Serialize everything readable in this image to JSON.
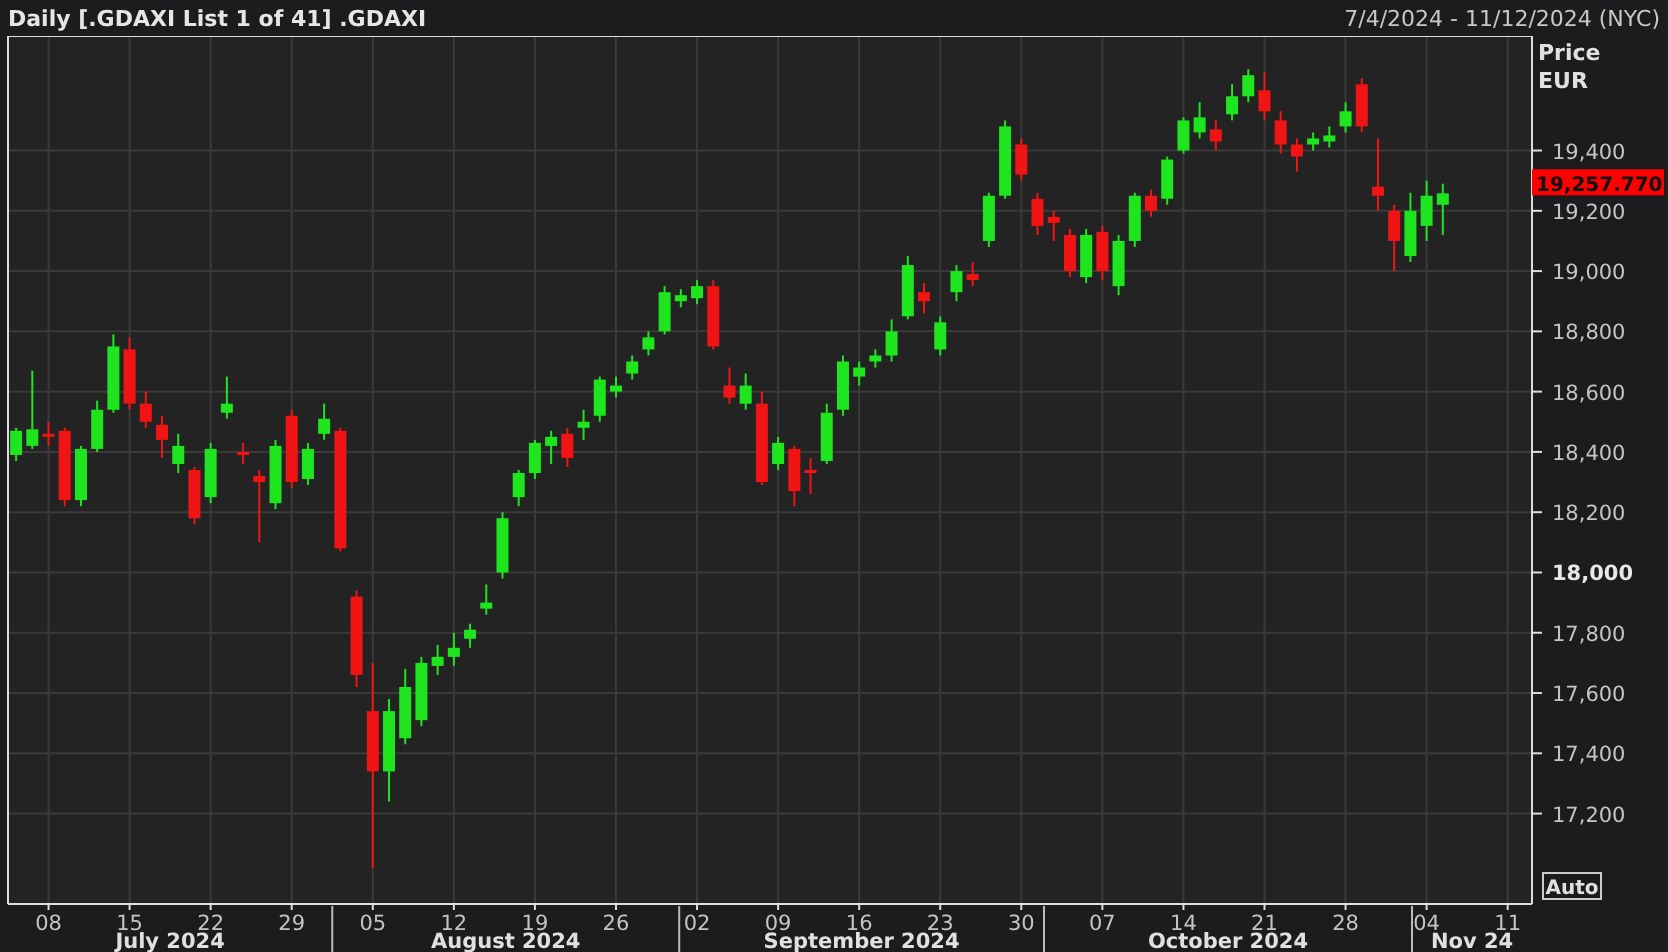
{
  "header": {
    "title": "Daily [.GDAXI List 1 of 41] .GDAXI",
    "range": "7/4/2024 - 11/12/2024 (NYC)"
  },
  "chart_data": {
    "type": "candlestick",
    "ylabel": "Price",
    "grid": true,
    "categories": [
      null,
      null,
      "08",
      null,
      null,
      null,
      null,
      "15",
      null,
      null,
      null,
      null,
      "22",
      null,
      null,
      null,
      null,
      "29",
      null,
      null,
      null,
      null,
      "05",
      null,
      null,
      null,
      null,
      "12",
      null,
      null,
      null,
      null,
      "19",
      null,
      null,
      null,
      null,
      "26",
      null,
      null,
      null,
      null,
      "02",
      null,
      null,
      null,
      null,
      "09",
      null,
      null,
      null,
      null,
      "16",
      null,
      null,
      null,
      null,
      "23",
      null,
      null,
      null,
      null,
      "30",
      null,
      null,
      null,
      null,
      "07",
      null,
      null,
      null,
      null,
      "14",
      null,
      null,
      null,
      null,
      "21",
      null,
      null,
      null,
      null,
      "28",
      null,
      null,
      null,
      null,
      "04",
      null,
      null,
      null,
      null,
      "11"
    ],
    "ohlc": [
      [
        18390,
        18480,
        18370,
        18470
      ],
      [
        18420,
        18670,
        18410,
        18475
      ],
      [
        18460,
        18500,
        18420,
        18450
      ],
      [
        18470,
        18480,
        18220,
        18240
      ],
      [
        18240,
        18420,
        18220,
        18410
      ],
      [
        18410,
        18570,
        18400,
        18540
      ],
      [
        18540,
        18790,
        18530,
        18750
      ],
      [
        18740,
        18780,
        18540,
        18560
      ],
      [
        18560,
        18600,
        18480,
        18500
      ],
      [
        18490,
        18520,
        18380,
        18440
      ],
      [
        18360,
        18460,
        18330,
        18420
      ],
      [
        18340,
        18350,
        18160,
        18180
      ],
      [
        18250,
        18430,
        18230,
        18410
      ],
      [
        18530,
        18650,
        18510,
        18560
      ],
      [
        18400,
        18430,
        18360,
        18390
      ],
      [
        18320,
        18340,
        18100,
        18300
      ],
      [
        18230,
        18440,
        18210,
        18420
      ],
      [
        18520,
        18540,
        18280,
        18300
      ],
      [
        18310,
        18430,
        18290,
        18410
      ],
      [
        18460,
        18560,
        18440,
        18510
      ],
      [
        18470,
        18480,
        18070,
        18080
      ],
      [
        17920,
        17940,
        17620,
        17660
      ],
      [
        17540,
        17700,
        17020,
        17340
      ],
      [
        17340,
        17580,
        17240,
        17540
      ],
      [
        17450,
        17680,
        17430,
        17620
      ],
      [
        17510,
        17720,
        17490,
        17700
      ],
      [
        17690,
        17760,
        17660,
        17720
      ],
      [
        17720,
        17800,
        17690,
        17750
      ],
      [
        17780,
        17830,
        17750,
        17810
      ],
      [
        17880,
        17960,
        17860,
        17900
      ],
      [
        18000,
        18200,
        17980,
        18180
      ],
      [
        18250,
        18340,
        18220,
        18330
      ],
      [
        18330,
        18440,
        18310,
        18430
      ],
      [
        18420,
        18470,
        18360,
        18450
      ],
      [
        18460,
        18480,
        18350,
        18380
      ],
      [
        18480,
        18540,
        18440,
        18500
      ],
      [
        18520,
        18650,
        18500,
        18640
      ],
      [
        18600,
        18650,
        18580,
        18620
      ],
      [
        18660,
        18720,
        18640,
        18700
      ],
      [
        18740,
        18800,
        18720,
        18780
      ],
      [
        18800,
        18950,
        18790,
        18930
      ],
      [
        18900,
        18940,
        18880,
        18920
      ],
      [
        18910,
        18970,
        18890,
        18950
      ],
      [
        18950,
        18970,
        18740,
        18750
      ],
      [
        18620,
        18680,
        18560,
        18580
      ],
      [
        18560,
        18660,
        18540,
        18620
      ],
      [
        18560,
        18600,
        18290,
        18300
      ],
      [
        18360,
        18450,
        18340,
        18430
      ],
      [
        18410,
        18420,
        18220,
        18270
      ],
      [
        18340,
        18380,
        18260,
        18330
      ],
      [
        18370,
        18560,
        18360,
        18530
      ],
      [
        18540,
        18720,
        18520,
        18700
      ],
      [
        18650,
        18700,
        18620,
        18680
      ],
      [
        18700,
        18740,
        18680,
        18720
      ],
      [
        18720,
        18840,
        18700,
        18800
      ],
      [
        18850,
        19050,
        18840,
        19020
      ],
      [
        18930,
        18960,
        18860,
        18900
      ],
      [
        18740,
        18850,
        18720,
        18830
      ],
      [
        18930,
        19020,
        18900,
        19000
      ],
      [
        18990,
        19030,
        18950,
        18970
      ],
      [
        19100,
        19260,
        19080,
        19250
      ],
      [
        19250,
        19500,
        19240,
        19480
      ],
      [
        19420,
        19440,
        19300,
        19320
      ],
      [
        19240,
        19260,
        19120,
        19150
      ],
      [
        19180,
        19200,
        19100,
        19160
      ],
      [
        19120,
        19140,
        18980,
        19000
      ],
      [
        18980,
        19140,
        18960,
        19120
      ],
      [
        19130,
        19150,
        18970,
        19000
      ],
      [
        18950,
        19120,
        18920,
        19100
      ],
      [
        19100,
        19260,
        19080,
        19250
      ],
      [
        19250,
        19270,
        19180,
        19200
      ],
      [
        19240,
        19380,
        19220,
        19370
      ],
      [
        19400,
        19510,
        19390,
        19500
      ],
      [
        19460,
        19560,
        19440,
        19510
      ],
      [
        19470,
        19500,
        19400,
        19430
      ],
      [
        19520,
        19620,
        19500,
        19580
      ],
      [
        19580,
        19670,
        19560,
        19650
      ],
      [
        19600,
        19660,
        19500,
        19530
      ],
      [
        19500,
        19530,
        19390,
        19420
      ],
      [
        19420,
        19440,
        19330,
        19380
      ],
      [
        19420,
        19460,
        19400,
        19440
      ],
      [
        19430,
        19480,
        19410,
        19450
      ],
      [
        19480,
        19560,
        19460,
        19530
      ],
      [
        19620,
        19640,
        19460,
        19480
      ],
      [
        19280,
        19440,
        19200,
        19250
      ],
      [
        19200,
        19220,
        19000,
        19100
      ],
      [
        19050,
        19260,
        19030,
        19200
      ],
      [
        19150,
        19300,
        19100,
        19250
      ],
      [
        19220,
        19290,
        19120,
        19258
      ],
      null,
      null,
      null,
      null
    ],
    "ylim": [
      16900,
      19780
    ],
    "yticks": [
      {
        "value": 17200,
        "label": "17,200"
      },
      {
        "value": 17400,
        "label": "17,400"
      },
      {
        "value": 17600,
        "label": "17,600"
      },
      {
        "value": 17800,
        "label": "17,800"
      },
      {
        "value": 18000,
        "label": "18,000"
      },
      {
        "value": 18200,
        "label": "18,200"
      },
      {
        "value": 18400,
        "label": "18,400"
      },
      {
        "value": 18600,
        "label": "18,600"
      },
      {
        "value": 18800,
        "label": "18,800"
      },
      {
        "value": 19000,
        "label": "19,000"
      },
      {
        "value": 19200,
        "label": "19,200"
      },
      {
        "value": 19400,
        "label": "19,400"
      }
    ]
  },
  "unit_label": "EUR",
  "last_price": "19,257.770",
  "month_labels": [
    "July 2024",
    "August 2024",
    "September 2024",
    "October 2024",
    "Nov 24"
  ],
  "auto_button": {
    "label": "Auto"
  }
}
